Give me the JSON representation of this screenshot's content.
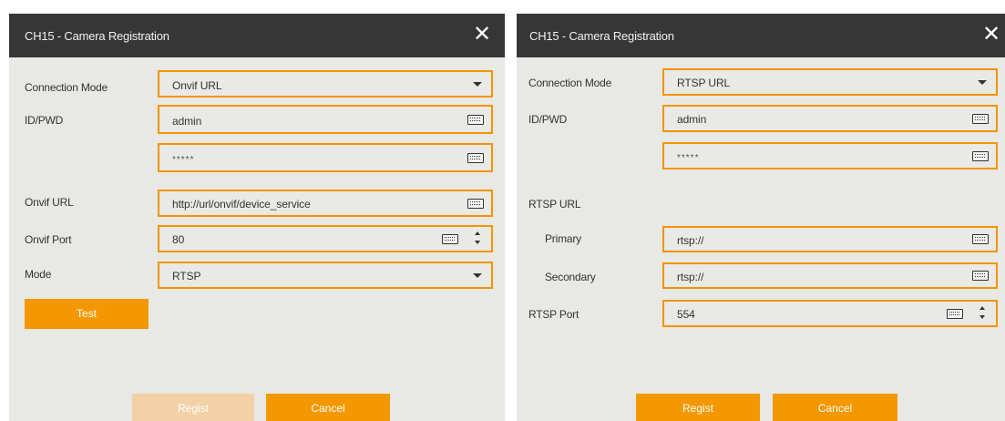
{
  "left": {
    "title": "CH15 - Camera Registration",
    "close_glyph": "✕",
    "connection_mode": {
      "label": "Connection Mode",
      "value": "Onvif URL"
    },
    "id_pwd": {
      "label": "ID/PWD",
      "id_value": "admin",
      "pwd_value": "*****"
    },
    "onvif_url": {
      "label": "Onvif URL",
      "value": "http://url/onvif/device_service"
    },
    "onvif_port": {
      "label": "Onvif Port",
      "value": "80"
    },
    "mode": {
      "label": "Mode",
      "value": "RTSP"
    },
    "test_button": "Test",
    "regist_button": "Regist",
    "cancel_button": "Cancel"
  },
  "right": {
    "title": "CH15 - Camera Registration",
    "close_glyph": "✕",
    "connection_mode": {
      "label": "Connection Mode",
      "value": "RTSP URL"
    },
    "id_pwd": {
      "label": "ID/PWD",
      "id_value": "admin",
      "pwd_value": "*****"
    },
    "rtsp_url": {
      "label": "RTSP URL",
      "primary_label": "Primary",
      "primary_value": "rtsp://",
      "secondary_label": "Secondary",
      "secondary_value": "rtsp://"
    },
    "rtsp_port": {
      "label": "RTSP Port",
      "value": "554"
    },
    "regist_button": "Regist",
    "cancel_button": "Cancel"
  },
  "icons": {
    "keyboard": "keyboard-icon",
    "dropdown": "chevron-down-icon",
    "spinner": "spinner-icon",
    "close": "close-icon"
  },
  "colors": {
    "accent": "#f39800",
    "accent_disabled": "#f2d1a6",
    "titlebar": "#363636",
    "panel": "#e8e8e4"
  }
}
